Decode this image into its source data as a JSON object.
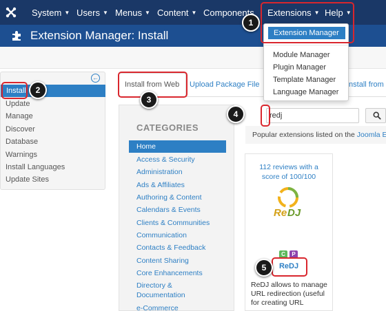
{
  "topnav": {
    "items": [
      {
        "label": "System"
      },
      {
        "label": "Users"
      },
      {
        "label": "Menus"
      },
      {
        "label": "Content"
      },
      {
        "label": "Components"
      },
      {
        "label": "Extensions"
      },
      {
        "label": "Help"
      }
    ]
  },
  "extensions_menu": {
    "items": [
      {
        "label": "Extension Manager"
      },
      {
        "label": "Module Manager"
      },
      {
        "label": "Plugin Manager"
      },
      {
        "label": "Template Manager"
      },
      {
        "label": "Language Manager"
      }
    ]
  },
  "header": {
    "title": "Extension Manager: Install"
  },
  "sidebar": {
    "items": [
      {
        "label": "Install"
      },
      {
        "label": "Update"
      },
      {
        "label": "Manage"
      },
      {
        "label": "Discover"
      },
      {
        "label": "Database"
      },
      {
        "label": "Warnings"
      },
      {
        "label": "Install Languages"
      },
      {
        "label": "Update Sites"
      }
    ]
  },
  "tabs": {
    "items": [
      {
        "label": "Install from Web"
      },
      {
        "label": "Upload Package File"
      },
      {
        "label": "Install from U"
      }
    ]
  },
  "categories": {
    "title": "CATEGORIES",
    "items": [
      {
        "label": "Home"
      },
      {
        "label": "Access & Security"
      },
      {
        "label": "Administration"
      },
      {
        "label": "Ads & Affiliates"
      },
      {
        "label": "Authoring & Content"
      },
      {
        "label": "Calendars & Events"
      },
      {
        "label": "Clients & Communities"
      },
      {
        "label": "Communication"
      },
      {
        "label": "Contacts & Feedback"
      },
      {
        "label": "Content Sharing"
      },
      {
        "label": "Core Enhancements"
      },
      {
        "label": "Directory &"
      },
      {
        "label": "Documentation"
      },
      {
        "label": "e-Commerce"
      }
    ]
  },
  "search": {
    "value": "redj"
  },
  "popular": {
    "text": "Popular extensions listed on the ",
    "link": "Joomla Ext"
  },
  "extension": {
    "reviews_line1": "112 reviews with a",
    "reviews_line2": "score of 100/100",
    "logo_text_top": "Re",
    "logo_text_bottom": "DJ",
    "badge_c": "C",
    "badge_p": "P",
    "name": "ReDJ",
    "desc_line1": "ReDJ allows to manage",
    "desc_line2": "URL redirection (useful",
    "desc_line3": "for creating URL"
  },
  "callouts": [
    "1",
    "2",
    "3",
    "4",
    "5"
  ],
  "colors": {
    "nav_bg": "#1a3867",
    "header_bg": "#1d4f91",
    "accent": "#2d7fc4",
    "highlight": "#d9262d"
  },
  "icons": {
    "logo": "joomla-logo-icon",
    "header": "puzzle-icon",
    "search": "search-icon",
    "sidebar_toggle": "collapse-arrow-icon"
  }
}
